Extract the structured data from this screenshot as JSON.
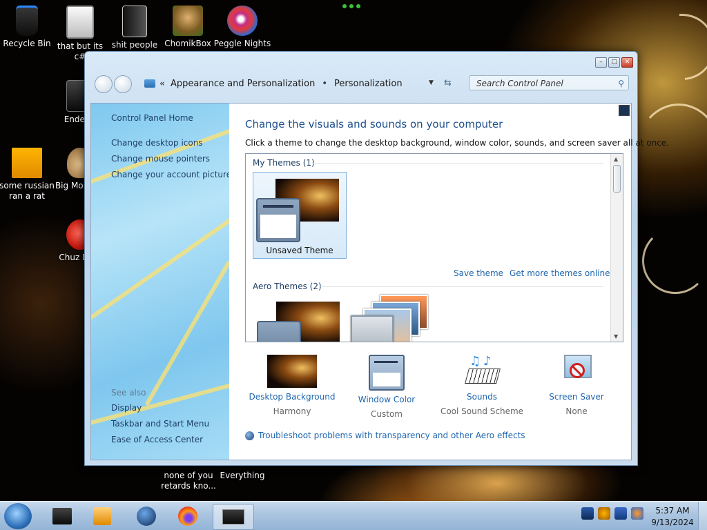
{
  "desktop": {
    "icons": [
      {
        "label": "Recycle Bin"
      },
      {
        "label": "that but its c#"
      },
      {
        "label": "shit people"
      },
      {
        "label": "ChomikBox"
      },
      {
        "label": "Peggle Nights"
      },
      {
        "label": "Enderm"
      },
      {
        "label": "some russian ran a rat"
      },
      {
        "label": "Big Mo Delu"
      },
      {
        "label": "Chuz Delu"
      },
      {
        "label": "none of you retards kno..."
      },
      {
        "label": "Everything"
      }
    ]
  },
  "window": {
    "breadcrumb_parent": "Appearance and Personalization",
    "breadcrumb_current": "Personalization",
    "overflow_chevron": "«",
    "separator": "•",
    "search_placeholder": "Search Control Panel",
    "sidebar": {
      "home": "Control Panel Home",
      "links": [
        "Change desktop icons",
        "Change mouse pointers",
        "Change your account picture"
      ],
      "see_also_label": "See also",
      "see_also": [
        "Display",
        "Taskbar and Start Menu",
        "Ease of Access Center"
      ]
    },
    "heading": "Change the visuals and sounds on your computer",
    "subheading": "Click a theme to change the desktop background, window color, sounds, and screen saver all at once.",
    "my_themes_label": "My Themes (1)",
    "unsaved_theme": "Unsaved Theme",
    "save_theme": "Save theme",
    "get_more_themes": "Get more themes online",
    "aero_themes_label": "Aero Themes (2)",
    "bottom": [
      {
        "title": "Desktop Background",
        "value": "Harmony",
        "icon": "wallpaper-thumbnail"
      },
      {
        "title": "Window Color",
        "value": "Custom",
        "icon": "window-color-icon"
      },
      {
        "title": "Sounds",
        "value": "Cool Sound Scheme",
        "icon": "sounds-piano-icon"
      },
      {
        "title": "Screen Saver",
        "value": "None",
        "icon": "screensaver-none-icon"
      }
    ],
    "troubleshoot": "Troubleshoot problems with transparency and other Aero effects"
  },
  "taskbar": {
    "time": "5:37 AM",
    "date": "9/13/2024"
  }
}
